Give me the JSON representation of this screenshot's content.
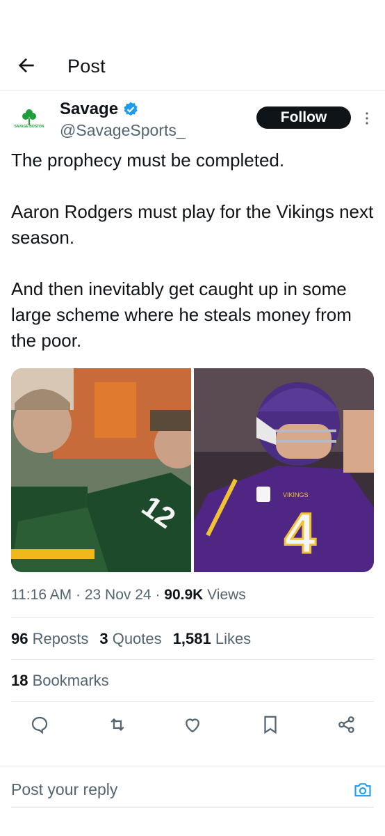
{
  "header": {
    "title": "Post"
  },
  "author": {
    "name": "Savage",
    "handle": "@SavageSports_",
    "avatar_text": "SAVAGE BOSTON",
    "verified": true
  },
  "follow_label": "Follow",
  "tweet": {
    "text": "The prophecy must be completed.\n\nAaron Rodgers must play for the Vikings next season.\n\nAnd then inevitably get caught up in some large scheme where he steals money from the poor."
  },
  "media": [
    {
      "jersey_number": "12"
    },
    {
      "jersey_number": "4",
      "jersey_text": "VIKINGS"
    }
  ],
  "meta": {
    "time": "11:16 AM",
    "date": "23 Nov 24",
    "views_count": "90.9K",
    "views_label": "Views",
    "sep": "·"
  },
  "stats": {
    "reposts_count": "96",
    "reposts_label": "Reposts",
    "quotes_count": "3",
    "quotes_label": "Quotes",
    "likes_count": "1,581",
    "likes_label": "Likes",
    "bookmarks_count": "18",
    "bookmarks_label": "Bookmarks"
  },
  "actions": [
    "reply-icon",
    "repost-icon",
    "like-icon",
    "bookmark-icon",
    "share-icon"
  ],
  "reply": {
    "placeholder": "Post your reply"
  },
  "colors": {
    "accent": "#1d9bf0",
    "text": "#0f1419",
    "secondary": "#536471",
    "divider": "#e6e9ec"
  }
}
